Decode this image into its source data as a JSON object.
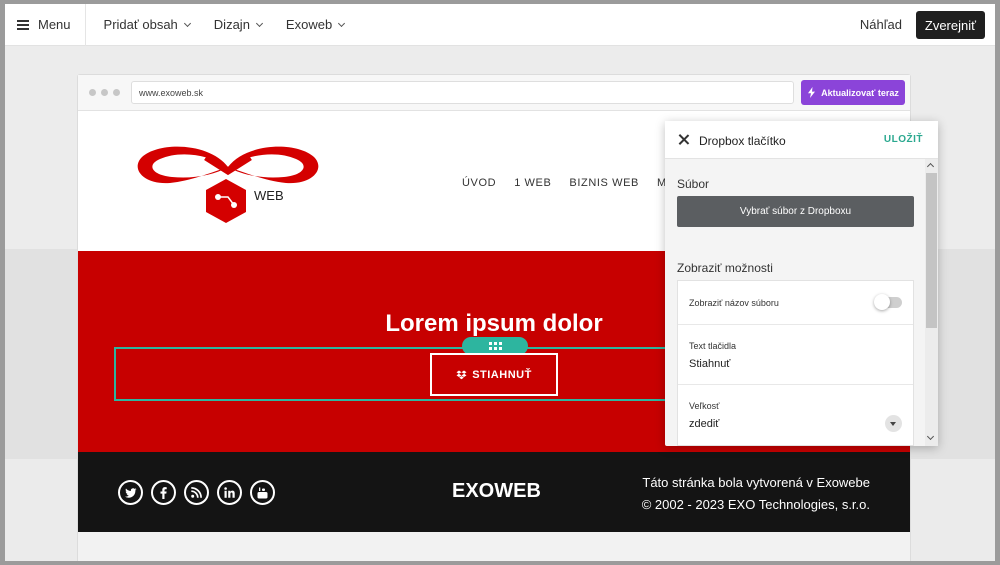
{
  "topbar": {
    "menu_label": "Menu",
    "items": [
      {
        "label": "Pridať obsah"
      },
      {
        "label": "Dizajn"
      },
      {
        "label": "Exoweb"
      }
    ],
    "preview_label": "Náhľad",
    "publish_label": "Zverejniť"
  },
  "browser": {
    "url": "www.exoweb.sk",
    "update_label": "Aktualizovať teraz",
    "update_color": "#8b44d9"
  },
  "site": {
    "logo_text": "WEB",
    "nav": [
      "ÚVOD",
      "1 WEB",
      "BIZNIS WEB",
      "MA"
    ],
    "hero_title": "Lorem ipsum dolor",
    "download_label": "STIAHNUŤ",
    "hero_color": "#c70000",
    "socials": [
      "twitter-icon",
      "facebook-icon",
      "rss-icon",
      "linkedin-icon",
      "youtube-icon"
    ],
    "footer_brand": "EXOWEB",
    "footer_line1": "Táto stránka bola vytvorená v Exowebe",
    "footer_line2": "© 2002 - 2023 EXO Technologies, s.r.o."
  },
  "panel": {
    "title": "Dropbox tlačítko",
    "save_label": "ULOŽIŤ",
    "file_section": "Súbor",
    "pick_file_label": "Vybrať súbor z Dropboxu",
    "options_section": "Zobraziť možnosti",
    "show_filename_label": "Zobraziť názov súboru",
    "button_text_label": "Text tlačidla",
    "button_text_value": "Stiahnuť",
    "size_label": "Veľkosť",
    "size_value": "zdediť",
    "accent_color": "#2db59f"
  }
}
